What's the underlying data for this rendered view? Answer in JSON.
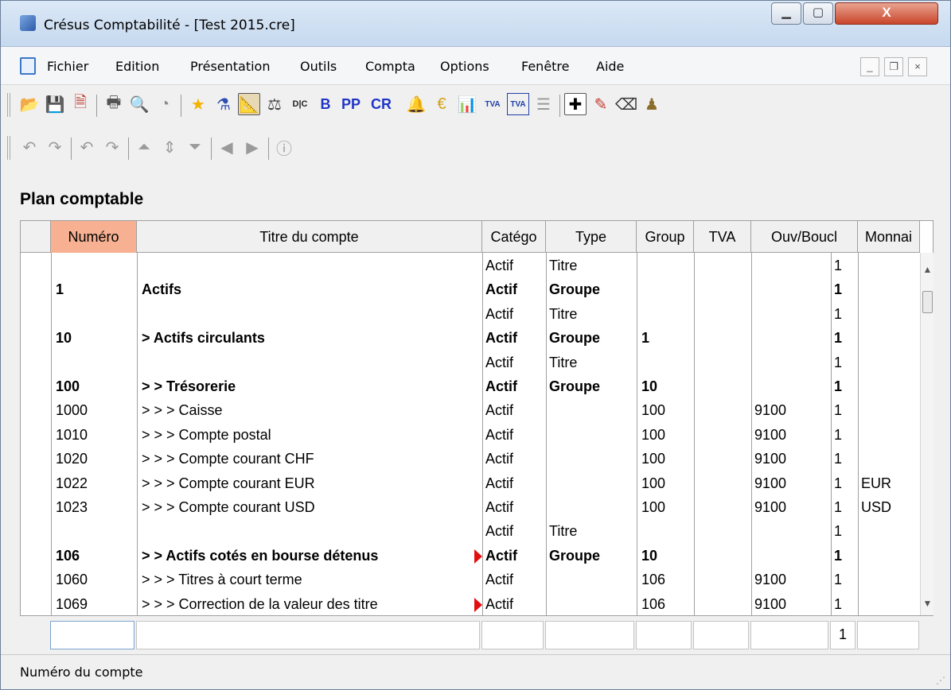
{
  "window": {
    "title": "Crésus Comptabilité - [Test 2015.cre]",
    "controls": {
      "minimize": "▁",
      "maximize": "▢",
      "close": "X"
    }
  },
  "menu": {
    "items": [
      "Fichier",
      "Edition",
      "Présentation",
      "Outils",
      "Compta",
      "Options",
      "Fenêtre",
      "Aide"
    ],
    "mdi": {
      "minimize": "_",
      "restore": "❐",
      "close": "×"
    }
  },
  "toolbar": {
    "balance_sheet": "B",
    "profit_loss": "PP",
    "cr": "CR",
    "tva_label": "TVA",
    "dc_label": "D|C"
  },
  "section": {
    "title": "Plan comptable"
  },
  "table": {
    "columns": [
      "Numéro",
      "Titre du compte",
      "Catégo",
      "Type",
      "Group",
      "TVA",
      "Ouv/Boucl",
      "Monnai"
    ],
    "rows": [
      {
        "num": "",
        "title": "",
        "cat": "Actif",
        "type": "Titre",
        "group": "",
        "tva": "",
        "ouv": "",
        "flag": "1",
        "cur": "",
        "bold": false
      },
      {
        "num": "1",
        "title": "Actifs",
        "cat": "Actif",
        "type": "Groupe",
        "group": "",
        "tva": "",
        "ouv": "",
        "flag": "1",
        "cur": "",
        "bold": true
      },
      {
        "num": "",
        "title": "",
        "cat": "Actif",
        "type": "Titre",
        "group": "",
        "tva": "",
        "ouv": "",
        "flag": "1",
        "cur": "",
        "bold": false
      },
      {
        "num": "10",
        "title": "> Actifs circulants",
        "cat": "Actif",
        "type": "Groupe",
        "group": "1",
        "tva": "",
        "ouv": "",
        "flag": "1",
        "cur": "",
        "bold": true
      },
      {
        "num": "",
        "title": "",
        "cat": "Actif",
        "type": "Titre",
        "group": "",
        "tva": "",
        "ouv": "",
        "flag": "1",
        "cur": "",
        "bold": false
      },
      {
        "num": "100",
        "title": "> > Trésorerie",
        "cat": "Actif",
        "type": "Groupe",
        "group": "10",
        "tva": "",
        "ouv": "",
        "flag": "1",
        "cur": "",
        "bold": true
      },
      {
        "num": "1000",
        "title": "> > > Caisse",
        "cat": "Actif",
        "type": "",
        "group": "100",
        "tva": "",
        "ouv": "9100",
        "flag": "1",
        "cur": "",
        "bold": false
      },
      {
        "num": "1010",
        "title": "> > > Compte postal",
        "cat": "Actif",
        "type": "",
        "group": "100",
        "tva": "",
        "ouv": "9100",
        "flag": "1",
        "cur": "",
        "bold": false
      },
      {
        "num": "1020",
        "title": "> > > Compte courant CHF",
        "cat": "Actif",
        "type": "",
        "group": "100",
        "tva": "",
        "ouv": "9100",
        "flag": "1",
        "cur": "",
        "bold": false
      },
      {
        "num": "1022",
        "title": "> > > Compte courant EUR",
        "cat": "Actif",
        "type": "",
        "group": "100",
        "tva": "",
        "ouv": "9100",
        "flag": "1",
        "cur": "EUR",
        "bold": false
      },
      {
        "num": "1023",
        "title": "> > > Compte courant USD",
        "cat": "Actif",
        "type": "",
        "group": "100",
        "tva": "",
        "ouv": "9100",
        "flag": "1",
        "cur": "USD",
        "bold": false
      },
      {
        "num": "",
        "title": "",
        "cat": "Actif",
        "type": "Titre",
        "group": "",
        "tva": "",
        "ouv": "",
        "flag": "1",
        "cur": "",
        "bold": false
      },
      {
        "num": "106",
        "title": "> > Actifs cotés en bourse détenus",
        "cat": "Actif",
        "type": "Groupe",
        "group": "10",
        "tva": "",
        "ouv": "",
        "flag": "1",
        "cur": "",
        "bold": true,
        "truncated": true
      },
      {
        "num": "1060",
        "title": "> > > Titres à court terme",
        "cat": "Actif",
        "type": "",
        "group": "106",
        "tva": "",
        "ouv": "9100",
        "flag": "1",
        "cur": "",
        "bold": false
      },
      {
        "num": "1069",
        "title": "> > > Correction de la valeur des titre",
        "cat": "Actif",
        "type": "",
        "group": "106",
        "tva": "",
        "ouv": "9100",
        "flag": "1",
        "cur": "",
        "bold": false,
        "truncated": true
      }
    ]
  },
  "edit_row": {
    "flag_value": "1"
  },
  "status": {
    "text": "Numéro du compte"
  },
  "colors": {
    "active_header": "#f7b091",
    "truncation_marker": "#e01010"
  }
}
